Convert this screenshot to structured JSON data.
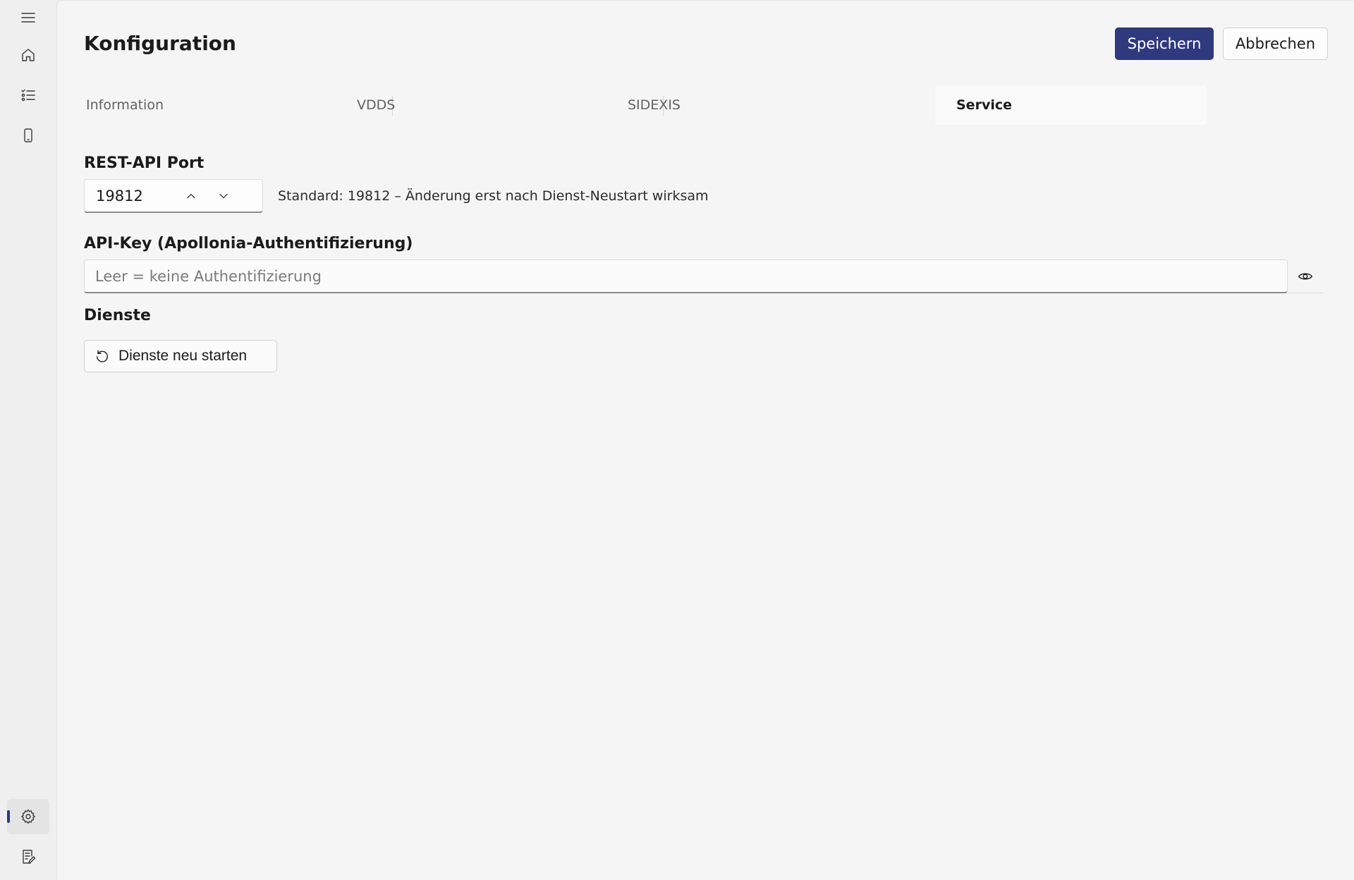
{
  "theme": {
    "accent": "#2f3a7e",
    "rail_indicator": "#2f3a7e"
  },
  "rail": {
    "items": [
      {
        "icon": "hamburger-menu-icon"
      },
      {
        "icon": "home-icon"
      },
      {
        "icon": "checklist-icon"
      },
      {
        "icon": "mobile-device-icon"
      },
      {
        "icon": "gear-icon",
        "selected": true
      },
      {
        "icon": "document-edit-icon"
      }
    ]
  },
  "header": {
    "title": "Konfiguration",
    "save_label": "Speichern",
    "cancel_label": "Abbrechen"
  },
  "tabs": [
    {
      "label": "Information",
      "active": false
    },
    {
      "label": "VDDS",
      "active": false
    },
    {
      "label": "SIDEXIS",
      "active": false
    },
    {
      "label": "Service",
      "active": true
    }
  ],
  "port": {
    "label": "REST-API Port",
    "value": "19812",
    "hint": "Standard: 19812 – Änderung erst nach Dienst-Neustart wirksam"
  },
  "api_key": {
    "label": "API-Key (Apollonia-Authentifizierung)",
    "value": "",
    "placeholder": "Leer = keine Authentifizierung"
  },
  "services": {
    "label": "Dienste",
    "restart_label": "Dienste neu starten"
  }
}
